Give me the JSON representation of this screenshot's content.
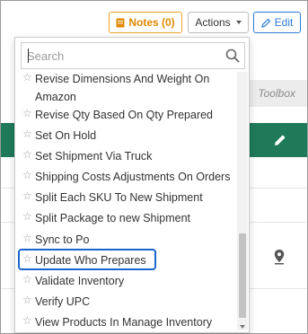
{
  "toolbar": {
    "notes_label": "Notes (0)",
    "actions_label": "Actions",
    "edit_label": "Edit"
  },
  "background": {
    "toolbox_label": "Toolbox"
  },
  "search": {
    "placeholder": "Search"
  },
  "menu": {
    "items": [
      {
        "label": "Revise Dimensions And Weight On Amazon"
      },
      {
        "label": "Revise Qty Based On Qty Prepared"
      },
      {
        "label": "Set On Hold"
      },
      {
        "label": "Set Shipment Via Truck"
      },
      {
        "label": "Shipping Costs Adjustments On Orders"
      },
      {
        "label": "Split Each SKU To New Shipment"
      },
      {
        "label": "Split Package to new Shipment"
      },
      {
        "label": "Sync to Po"
      },
      {
        "label": "Update Who Prepares"
      },
      {
        "label": "Validate Inventory"
      },
      {
        "label": "Verify UPC"
      },
      {
        "label": "View Products In Manage Inventory"
      }
    ],
    "highlighted": "Update Who Prepares"
  },
  "colors": {
    "notes_accent": "#f0a12a",
    "edit_accent": "#2a7bd8",
    "header_green": "#1f7a5a",
    "highlight_border": "#1a66cc"
  }
}
